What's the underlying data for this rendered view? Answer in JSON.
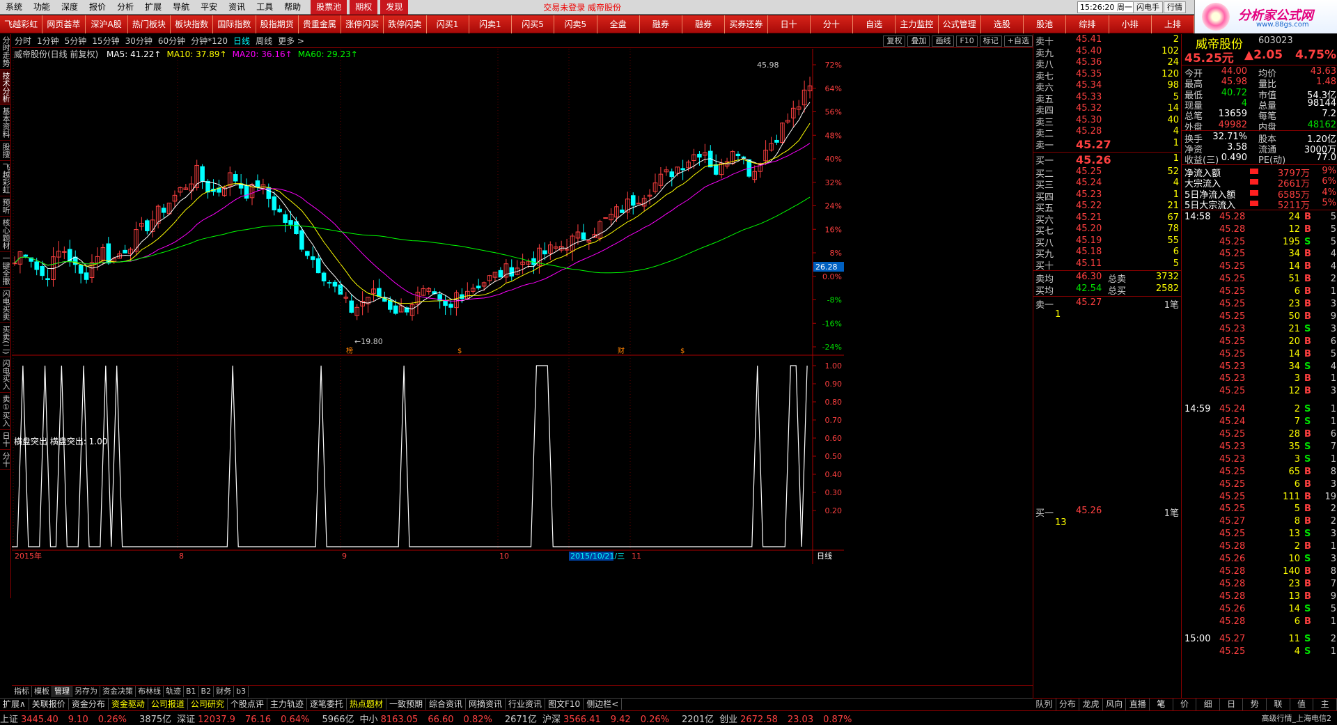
{
  "menubar": {
    "items": [
      "系统",
      "功能",
      "深度",
      "报价",
      "分析",
      "扩展",
      "导航",
      "平安",
      "资讯",
      "工具",
      "帮助"
    ],
    "highlight_items": [
      "股票池",
      "期权",
      "发现"
    ],
    "status": "交易未登录   威帝股份",
    "clock": "15:26:20 周一",
    "btn_flash": "闪电手",
    "btn_quote": "行情"
  },
  "logo": {
    "title": "分析家公式网",
    "url": "www.88gs.com"
  },
  "navbar": [
    "飞越彩虹",
    "网页荟萃",
    "深沪A股",
    "热门板块",
    "板块指数",
    "国际指数",
    "股指期货",
    "贵重金属",
    "涨停闪买",
    "跌停闪卖",
    "闪买1",
    "闪卖1",
    "闪买5",
    "闪卖5",
    "全盘",
    "融券",
    "融券",
    "买券还券",
    "日十",
    "分十",
    "自选",
    "主力监控",
    "公式管理",
    "选股",
    "股池",
    "综排",
    "小排",
    "上排"
  ],
  "leftvtabs": [
    "分时走势",
    "技术分析",
    "基本资料",
    "股搜",
    "飞越彩虹",
    "预听",
    "核心题材",
    "一键全撤",
    "闪电买卖",
    "买卖(二)",
    "闪电买入",
    "卖①买入",
    "日十",
    "分十"
  ],
  "periodbar": {
    "items": [
      "分时",
      "1分钟",
      "5分钟",
      "15分钟",
      "30分钟",
      "60分钟",
      "分钟*120",
      "日线",
      "周线",
      "更多 >"
    ],
    "active": "日线",
    "right": [
      "复权",
      "叠加",
      "画线",
      "F10",
      "标记",
      "+自选"
    ]
  },
  "chart": {
    "stock_title": "威帝股份(日线 前复权)",
    "ma": [
      {
        "label": "MA5: 41.22",
        "color": "#ffffff"
      },
      {
        "label": "MA10: 37.89",
        "color": "#ffff00"
      },
      {
        "label": "MA20: 36.16",
        "color": "#ff00ff"
      },
      {
        "label": "MA60: 29.23",
        "color": "#00ff00"
      }
    ],
    "y_ticks": [
      "72%",
      "64%",
      "56%",
      "48%",
      "40%",
      "32%",
      "24%",
      "16%",
      "8%",
      "0.0%",
      "-8%",
      "-16%",
      "-24%"
    ],
    "price_tag": "26.28",
    "high_label": "45.98",
    "low_label": "19.80",
    "markers": [
      "榜",
      "$",
      "财",
      "$"
    ],
    "x_labels": [
      "2015年",
      "8",
      "9",
      "10",
      "2015/10/21/三",
      "11"
    ],
    "period_label": "日线",
    "sub_title": "横盘突出  横盘突出: 1.00",
    "sub_ticks": [
      "1.00",
      "0.90",
      "0.80",
      "0.70",
      "0.60",
      "0.50",
      "0.40",
      "0.30",
      "0.20"
    ],
    "sub_values": [
      0,
      0,
      1,
      0,
      0,
      0,
      1,
      0,
      0,
      1,
      0,
      0,
      0,
      1,
      0,
      0,
      0,
      1,
      0,
      1,
      0,
      0,
      0,
      0,
      0,
      0,
      0,
      0,
      0,
      0,
      0,
      0,
      0,
      0,
      0,
      0,
      0,
      0,
      0,
      0,
      1,
      0,
      0,
      0,
      0,
      0,
      0,
      0,
      0,
      0,
      0,
      0,
      0,
      0,
      0,
      0,
      1,
      0,
      0,
      0,
      0,
      0,
      0,
      0,
      0,
      0,
      0,
      0,
      0,
      0,
      0,
      1,
      0,
      0,
      0,
      0,
      0,
      0,
      0,
      0,
      0,
      0,
      0,
      0,
      0,
      0,
      0,
      0,
      0,
      0,
      0,
      0,
      0,
      0,
      0,
      1,
      1,
      1,
      0,
      0,
      0,
      0,
      0,
      0,
      0,
      0,
      0,
      0,
      0,
      0,
      0,
      0,
      0,
      0,
      0,
      0,
      0,
      0,
      0,
      0,
      0,
      0,
      0,
      0,
      0,
      0,
      0,
      0,
      0,
      0,
      0,
      0,
      0,
      0,
      0,
      1,
      0,
      0,
      0,
      0,
      0,
      1,
      1,
      0,
      1
    ]
  },
  "bottomtabs": [
    "指标",
    "模板",
    "管理",
    "另存为",
    "资金决策",
    "布林线",
    "轨迹",
    "B1",
    "B2",
    "财务",
    "b3"
  ],
  "newsbar": [
    "扩展∧",
    "关联报价",
    "资金分布",
    "资金驱动",
    "公司报道",
    "公司研究",
    "个股点评",
    "主力轨迹",
    "逐笔委托",
    "热点题材",
    "一致预期",
    "综合资讯",
    "网摘资讯",
    "行业资讯",
    "图文F10",
    "侧边栏<"
  ],
  "indexbar": [
    {
      "name": "上证",
      "val": "3445.40",
      "chg": "9.10",
      "pct": "0.26%",
      "amt": "3875亿"
    },
    {
      "name": "深证",
      "val": "12037.9",
      "chg": "76.16",
      "pct": "0.64%",
      "amt": "5966亿"
    },
    {
      "name": "中小",
      "val": "8163.05",
      "chg": "66.60",
      "pct": "0.82%",
      "amt": "2671亿"
    },
    {
      "name": "沪深",
      "val": "3566.41",
      "chg": "9.42",
      "pct": "0.26%",
      "amt": "2201亿"
    },
    {
      "name": "创业",
      "val": "2672.58",
      "chg": "23.03",
      "pct": "0.87%",
      "amt": ""
    }
  ],
  "indexbar_tail": "高级行情_上海电信2",
  "orderbook": {
    "asks": [
      {
        "l": "卖十",
        "p": "45.41",
        "v": "2"
      },
      {
        "l": "卖九",
        "p": "45.40",
        "v": "102"
      },
      {
        "l": "卖八",
        "p": "45.36",
        "v": "24"
      },
      {
        "l": "卖七",
        "p": "45.35",
        "v": "120"
      },
      {
        "l": "卖六",
        "p": "45.34",
        "v": "98"
      },
      {
        "l": "卖五",
        "p": "45.33",
        "v": "5"
      },
      {
        "l": "卖四",
        "p": "45.32",
        "v": "14"
      },
      {
        "l": "卖三",
        "p": "45.30",
        "v": "40"
      },
      {
        "l": "卖二",
        "p": "45.28",
        "v": "4"
      },
      {
        "l": "卖一",
        "p": "45.27",
        "v": "1"
      }
    ],
    "bids": [
      {
        "l": "买一",
        "p": "45.26",
        "v": "1"
      },
      {
        "l": "买二",
        "p": "45.25",
        "v": "52"
      },
      {
        "l": "买三",
        "p": "45.24",
        "v": "4"
      },
      {
        "l": "买四",
        "p": "45.23",
        "v": "1"
      },
      {
        "l": "买五",
        "p": "45.22",
        "v": "21"
      },
      {
        "l": "买六",
        "p": "45.21",
        "v": "67"
      },
      {
        "l": "买七",
        "p": "45.20",
        "v": "78"
      },
      {
        "l": "买八",
        "p": "45.19",
        "v": "55"
      },
      {
        "l": "买九",
        "p": "45.18",
        "v": "6"
      },
      {
        "l": "买十",
        "p": "45.11",
        "v": "5"
      }
    ],
    "sell_avg": {
      "l": "卖均",
      "p": "46.30",
      "tl": "总卖",
      "v": "3732"
    },
    "buy_avg": {
      "l": "买均",
      "p": "42.54",
      "tl": "总买",
      "v": "2582"
    },
    "queue_sell": {
      "l": "卖一",
      "p": "45.27",
      "v": "1笔",
      "q": "1"
    },
    "queue_buy": {
      "l": "买一",
      "p": "45.26",
      "v": "1笔",
      "q": "13"
    }
  },
  "stockinfo": {
    "name": "威帝股份",
    "code": "603023",
    "price": "45.25元",
    "change": "▲2.05",
    "pct": "4.75%",
    "rows": [
      [
        "今开",
        "44.00",
        "均价",
        "43.63"
      ],
      [
        "最高",
        "45.98",
        "量比",
        "1.48"
      ],
      [
        "最低",
        "40.72",
        "市值",
        "54.3亿"
      ],
      [
        "现量",
        "4",
        "总量",
        "98144"
      ],
      [
        "总笔",
        "13659",
        "每笔",
        "7.2"
      ],
      [
        "外盘",
        "49982",
        "内盘",
        "48162"
      ],
      [
        "换手",
        "32.71%",
        "股本",
        "1.20亿"
      ],
      [
        "净资",
        "3.58",
        "流通",
        "3000万"
      ],
      [
        "收益(三)",
        "0.490",
        "PE(动)",
        "77.0"
      ]
    ],
    "flows": [
      [
        "净流入额",
        "3797万",
        "9%"
      ],
      [
        "大宗流入",
        "2661万",
        "6%"
      ],
      [
        "5日净流入额",
        "6585万",
        "4%"
      ],
      [
        "5日大宗流入",
        "5211万",
        "5%"
      ]
    ]
  },
  "ticks": [
    {
      "t": "14:58",
      "p": "45.28",
      "v": "24",
      "d": "B",
      "n": "5"
    },
    {
      "t": "",
      "p": "45.28",
      "v": "12",
      "d": "B",
      "n": "5"
    },
    {
      "t": "",
      "p": "45.25",
      "v": "195",
      "d": "S",
      "n": "5"
    },
    {
      "t": "",
      "p": "45.25",
      "v": "34",
      "d": "B",
      "n": "4"
    },
    {
      "t": "",
      "p": "45.25",
      "v": "14",
      "d": "B",
      "n": "4"
    },
    {
      "t": "",
      "p": "45.25",
      "v": "51",
      "d": "B",
      "n": "2"
    },
    {
      "t": "",
      "p": "45.25",
      "v": "6",
      "d": "B",
      "n": "1"
    },
    {
      "t": "",
      "p": "45.25",
      "v": "23",
      "d": "B",
      "n": "3"
    },
    {
      "t": "",
      "p": "45.25",
      "v": "50",
      "d": "B",
      "n": "9"
    },
    {
      "t": "",
      "p": "45.23",
      "v": "21",
      "d": "S",
      "n": "3"
    },
    {
      "t": "",
      "p": "45.25",
      "v": "20",
      "d": "B",
      "n": "6"
    },
    {
      "t": "",
      "p": "45.25",
      "v": "14",
      "d": "B",
      "n": "5"
    },
    {
      "t": "",
      "p": "45.23",
      "v": "34",
      "d": "S",
      "n": "4"
    },
    {
      "t": "",
      "p": "45.23",
      "v": "3",
      "d": "B",
      "n": "1"
    },
    {
      "t": "",
      "p": "45.25",
      "v": "12",
      "d": "B",
      "n": "3"
    },
    {
      "t": "14:59",
      "p": "45.24",
      "v": "2",
      "d": "S",
      "n": "1"
    },
    {
      "t": "",
      "p": "45.24",
      "v": "7",
      "d": "S",
      "n": "1"
    },
    {
      "t": "",
      "p": "45.25",
      "v": "28",
      "d": "B",
      "n": "6"
    },
    {
      "t": "",
      "p": "45.23",
      "v": "35",
      "d": "S",
      "n": "7"
    },
    {
      "t": "",
      "p": "45.23",
      "v": "3",
      "d": "S",
      "n": "1"
    },
    {
      "t": "",
      "p": "45.25",
      "v": "65",
      "d": "B",
      "n": "8"
    },
    {
      "t": "",
      "p": "45.25",
      "v": "6",
      "d": "B",
      "n": "3"
    },
    {
      "t": "",
      "p": "45.25",
      "v": "111",
      "d": "B",
      "n": "19"
    },
    {
      "t": "",
      "p": "45.25",
      "v": "5",
      "d": "B",
      "n": "2"
    },
    {
      "t": "",
      "p": "45.27",
      "v": "8",
      "d": "B",
      "n": "2"
    },
    {
      "t": "",
      "p": "45.25",
      "v": "13",
      "d": "S",
      "n": "3"
    },
    {
      "t": "",
      "p": "45.28",
      "v": "2",
      "d": "B",
      "n": "1"
    },
    {
      "t": "",
      "p": "45.26",
      "v": "10",
      "d": "S",
      "n": "3"
    },
    {
      "t": "",
      "p": "45.28",
      "v": "140",
      "d": "B",
      "n": "8"
    },
    {
      "t": "",
      "p": "45.28",
      "v": "23",
      "d": "B",
      "n": "7"
    },
    {
      "t": "",
      "p": "45.28",
      "v": "13",
      "d": "B",
      "n": "9"
    },
    {
      "t": "",
      "p": "45.26",
      "v": "14",
      "d": "S",
      "n": "5"
    },
    {
      "t": "",
      "p": "45.28",
      "v": "6",
      "d": "B",
      "n": "1"
    },
    {
      "t": "15:00",
      "p": "45.27",
      "v": "11",
      "d": "S",
      "n": "2"
    },
    {
      "t": "",
      "p": "45.25",
      "v": "4",
      "d": "S",
      "n": "1"
    }
  ],
  "rtabs": [
    "队列",
    "分布",
    "龙虎",
    "风向",
    "直播",
    "笔",
    "价",
    "细",
    "日",
    "势",
    "联",
    "值",
    "主"
  ]
}
